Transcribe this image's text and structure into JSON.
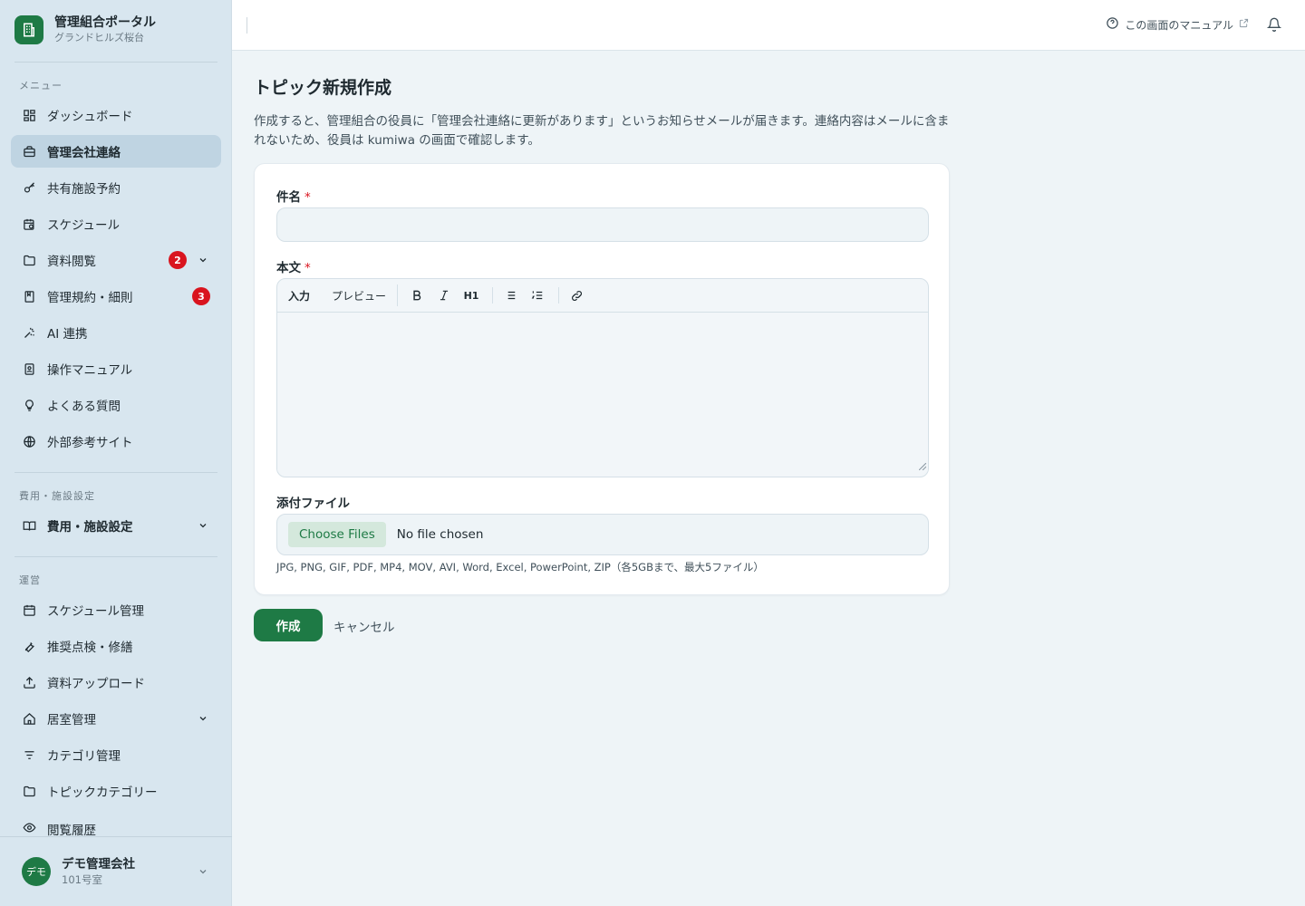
{
  "brand": {
    "title": "管理組合ポータル",
    "subtitle": "グランドヒルズ桜台",
    "icon": "building-icon"
  },
  "sidebar": {
    "section_menu": "メニュー",
    "menu_items": [
      {
        "label": "ダッシュボード",
        "icon": "dashboard-icon"
      },
      {
        "label": "管理会社連絡",
        "icon": "briefcase-icon",
        "active": true
      },
      {
        "label": "共有施設予約",
        "icon": "key-icon"
      },
      {
        "label": "スケジュール",
        "icon": "calendar-clock-icon"
      },
      {
        "label": "資料閲覧",
        "icon": "folder-icon",
        "badge": "2",
        "expandable": true
      },
      {
        "label": "管理規約・細則",
        "icon": "bookmark-icon",
        "badge": "3"
      },
      {
        "label": "AI 連携",
        "icon": "sparkle-icon"
      },
      {
        "label": "操作マニュアル",
        "icon": "manual-icon"
      },
      {
        "label": "よくある質問",
        "icon": "lightbulb-icon"
      },
      {
        "label": "外部参考サイト",
        "icon": "globe-icon"
      }
    ],
    "section_fees": "費用・施設設定",
    "fees_items": [
      {
        "label": "費用・施設設定",
        "icon": "book-open-icon",
        "expandable": true
      }
    ],
    "section_ops": "運営",
    "ops_items": [
      {
        "label": "スケジュール管理",
        "icon": "calendar-icon"
      },
      {
        "label": "推奨点検・修繕",
        "icon": "wrench-icon"
      },
      {
        "label": "資料アップロード",
        "icon": "upload-icon"
      },
      {
        "label": "居室管理",
        "icon": "home-icon",
        "expandable": true
      },
      {
        "label": "カテゴリ管理",
        "icon": "filter-icon"
      },
      {
        "label": "トピックカテゴリー",
        "icon": "folder-icon"
      },
      {
        "label": "閲覧履歴",
        "icon": "eye-icon"
      }
    ],
    "user": {
      "avatar": "デモ",
      "name": "デモ管理会社",
      "room": "101号室"
    }
  },
  "header": {
    "manual_link": "この画面のマニュアル"
  },
  "main": {
    "title": "トピック新規作成",
    "description": "作成すると、管理組合の役員に「管理会社連絡に更新があります」というお知らせメールが届きます。連絡内容はメールに含まれないため、役員は kumiwa の画面で確認します。",
    "subject_label": "件名",
    "subject_value": "",
    "body_label": "本文",
    "required_mark": "*",
    "editor_tabs": [
      "入力",
      "プレビュー"
    ],
    "editor_tools": {
      "h1": "H1"
    },
    "attach_label": "添付ファイル",
    "choose_files": "Choose Files",
    "no_file": "No file chosen",
    "attach_hint": "JPG, PNG, GIF, PDF, MP4, MOV, AVI, Word, Excel, PowerPoint, ZIP（各5GBまで、最大5ファイル）",
    "submit": "作成",
    "cancel": "キャンセル"
  },
  "colors": {
    "accent": "#1e7a45",
    "badge": "#d9141e",
    "sidebar_bg": "#d8e6ef",
    "page_bg": "#eef4f7"
  }
}
